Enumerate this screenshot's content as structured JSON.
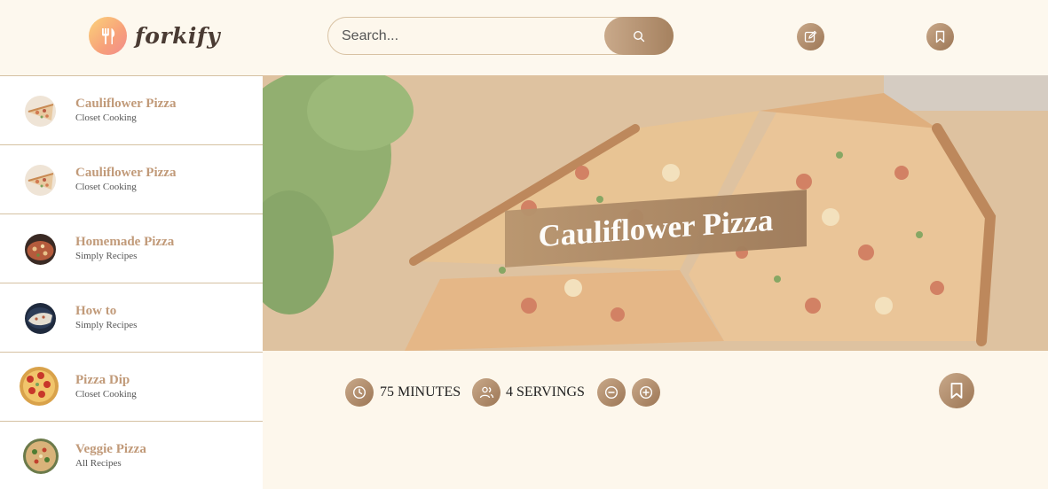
{
  "header": {
    "logo_text": "forkify",
    "search": {
      "placeholder": "Search...",
      "value": ""
    },
    "search_icon": "search-icon",
    "add_recipe_icon": "edit-icon",
    "bookmarks_icon": "bookmark-icon"
  },
  "results": [
    {
      "title": "Cauliflower Pizza",
      "publisher": "Closet Cooking",
      "thumb": "pizza-slice"
    },
    {
      "title": "Cauliflower Pizza",
      "publisher": "Closet Cooking",
      "thumb": "pizza-slice"
    },
    {
      "title": "Homemade Pizza",
      "publisher": "Simply Recipes",
      "thumb": "pizza-dark"
    },
    {
      "title": "How to",
      "publisher": "Simply Recipes",
      "thumb": "pizza-pan"
    },
    {
      "title": "Pizza Dip",
      "publisher": "Closet Cooking",
      "thumb": "pepperoni"
    },
    {
      "title": "Veggie Pizza",
      "publisher": "All Recipes",
      "thumb": "veggie"
    }
  ],
  "recipe": {
    "title": "Cauliflower Pizza",
    "minutes_value": "75",
    "minutes_label": "MINUTES",
    "servings_value": "4",
    "servings_label": "SERVINGS"
  },
  "colors": {
    "accent": "#c19a79",
    "gradient_start": "#c9a98a",
    "gradient_end": "#9c7655",
    "background": "#fdf7ec"
  }
}
